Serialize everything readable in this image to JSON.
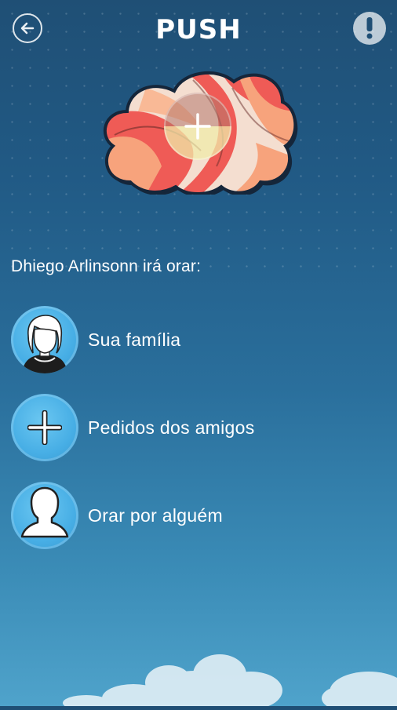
{
  "header": {
    "title": "PUSH",
    "back_icon": "arrow-left-icon",
    "alert_icon": "exclamation-icon"
  },
  "hero": {
    "image": "colorful-brain-cloud-illustration",
    "add_icon": "plus-icon"
  },
  "prompt": "Dhiego Arlinsonn irá orar:",
  "options": [
    {
      "label": "Sua família",
      "icon": "family-avatar-icon"
    },
    {
      "label": "Pedidos dos amigos",
      "icon": "plus-icon"
    },
    {
      "label": "Orar por alguém",
      "icon": "person-silhouette-icon"
    }
  ],
  "colors": {
    "background_top": "#1f4f75",
    "background_bottom": "#4fa3cb",
    "option_circle": "#47aee5"
  }
}
